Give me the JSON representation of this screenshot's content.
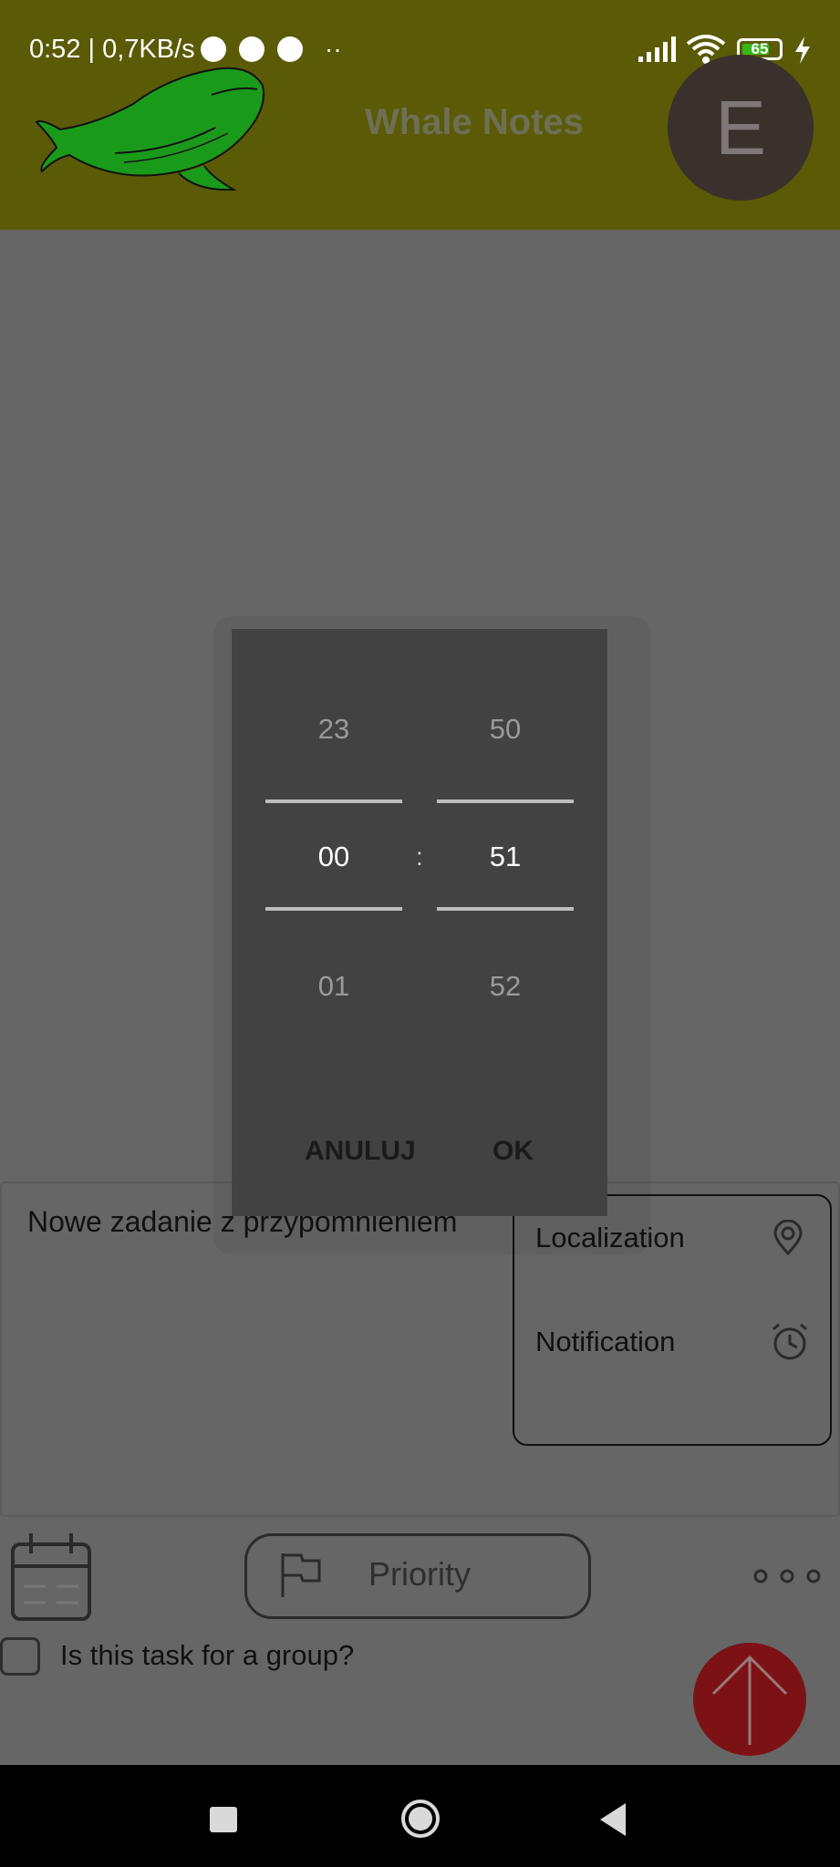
{
  "status_bar": {
    "time_speed": "0:52 | 0,7KB/s",
    "extra": "··",
    "battery": "65"
  },
  "header": {
    "title": "Whale Notes",
    "avatar_letter": "E"
  },
  "time_picker": {
    "hours": {
      "prev": "23",
      "selected": "00",
      "next": "01"
    },
    "minutes": {
      "prev": "50",
      "selected": "51",
      "next": "52"
    },
    "separator": ":",
    "cancel_label": "ANULUJ",
    "ok_label": "OK"
  },
  "task": {
    "text": "Nowe zadanie z przypomnieniem"
  },
  "options": {
    "localization_label": "Localization",
    "notification_label": "Notification"
  },
  "toolbar": {
    "priority_label": "Priority",
    "group_question": "Is this task for a group?"
  },
  "colors": {
    "header_bg": "#5b5a06",
    "dialog_bg": "#424242",
    "submit_bg": "#7c1215",
    "whale_green": "#1a9a1a"
  }
}
